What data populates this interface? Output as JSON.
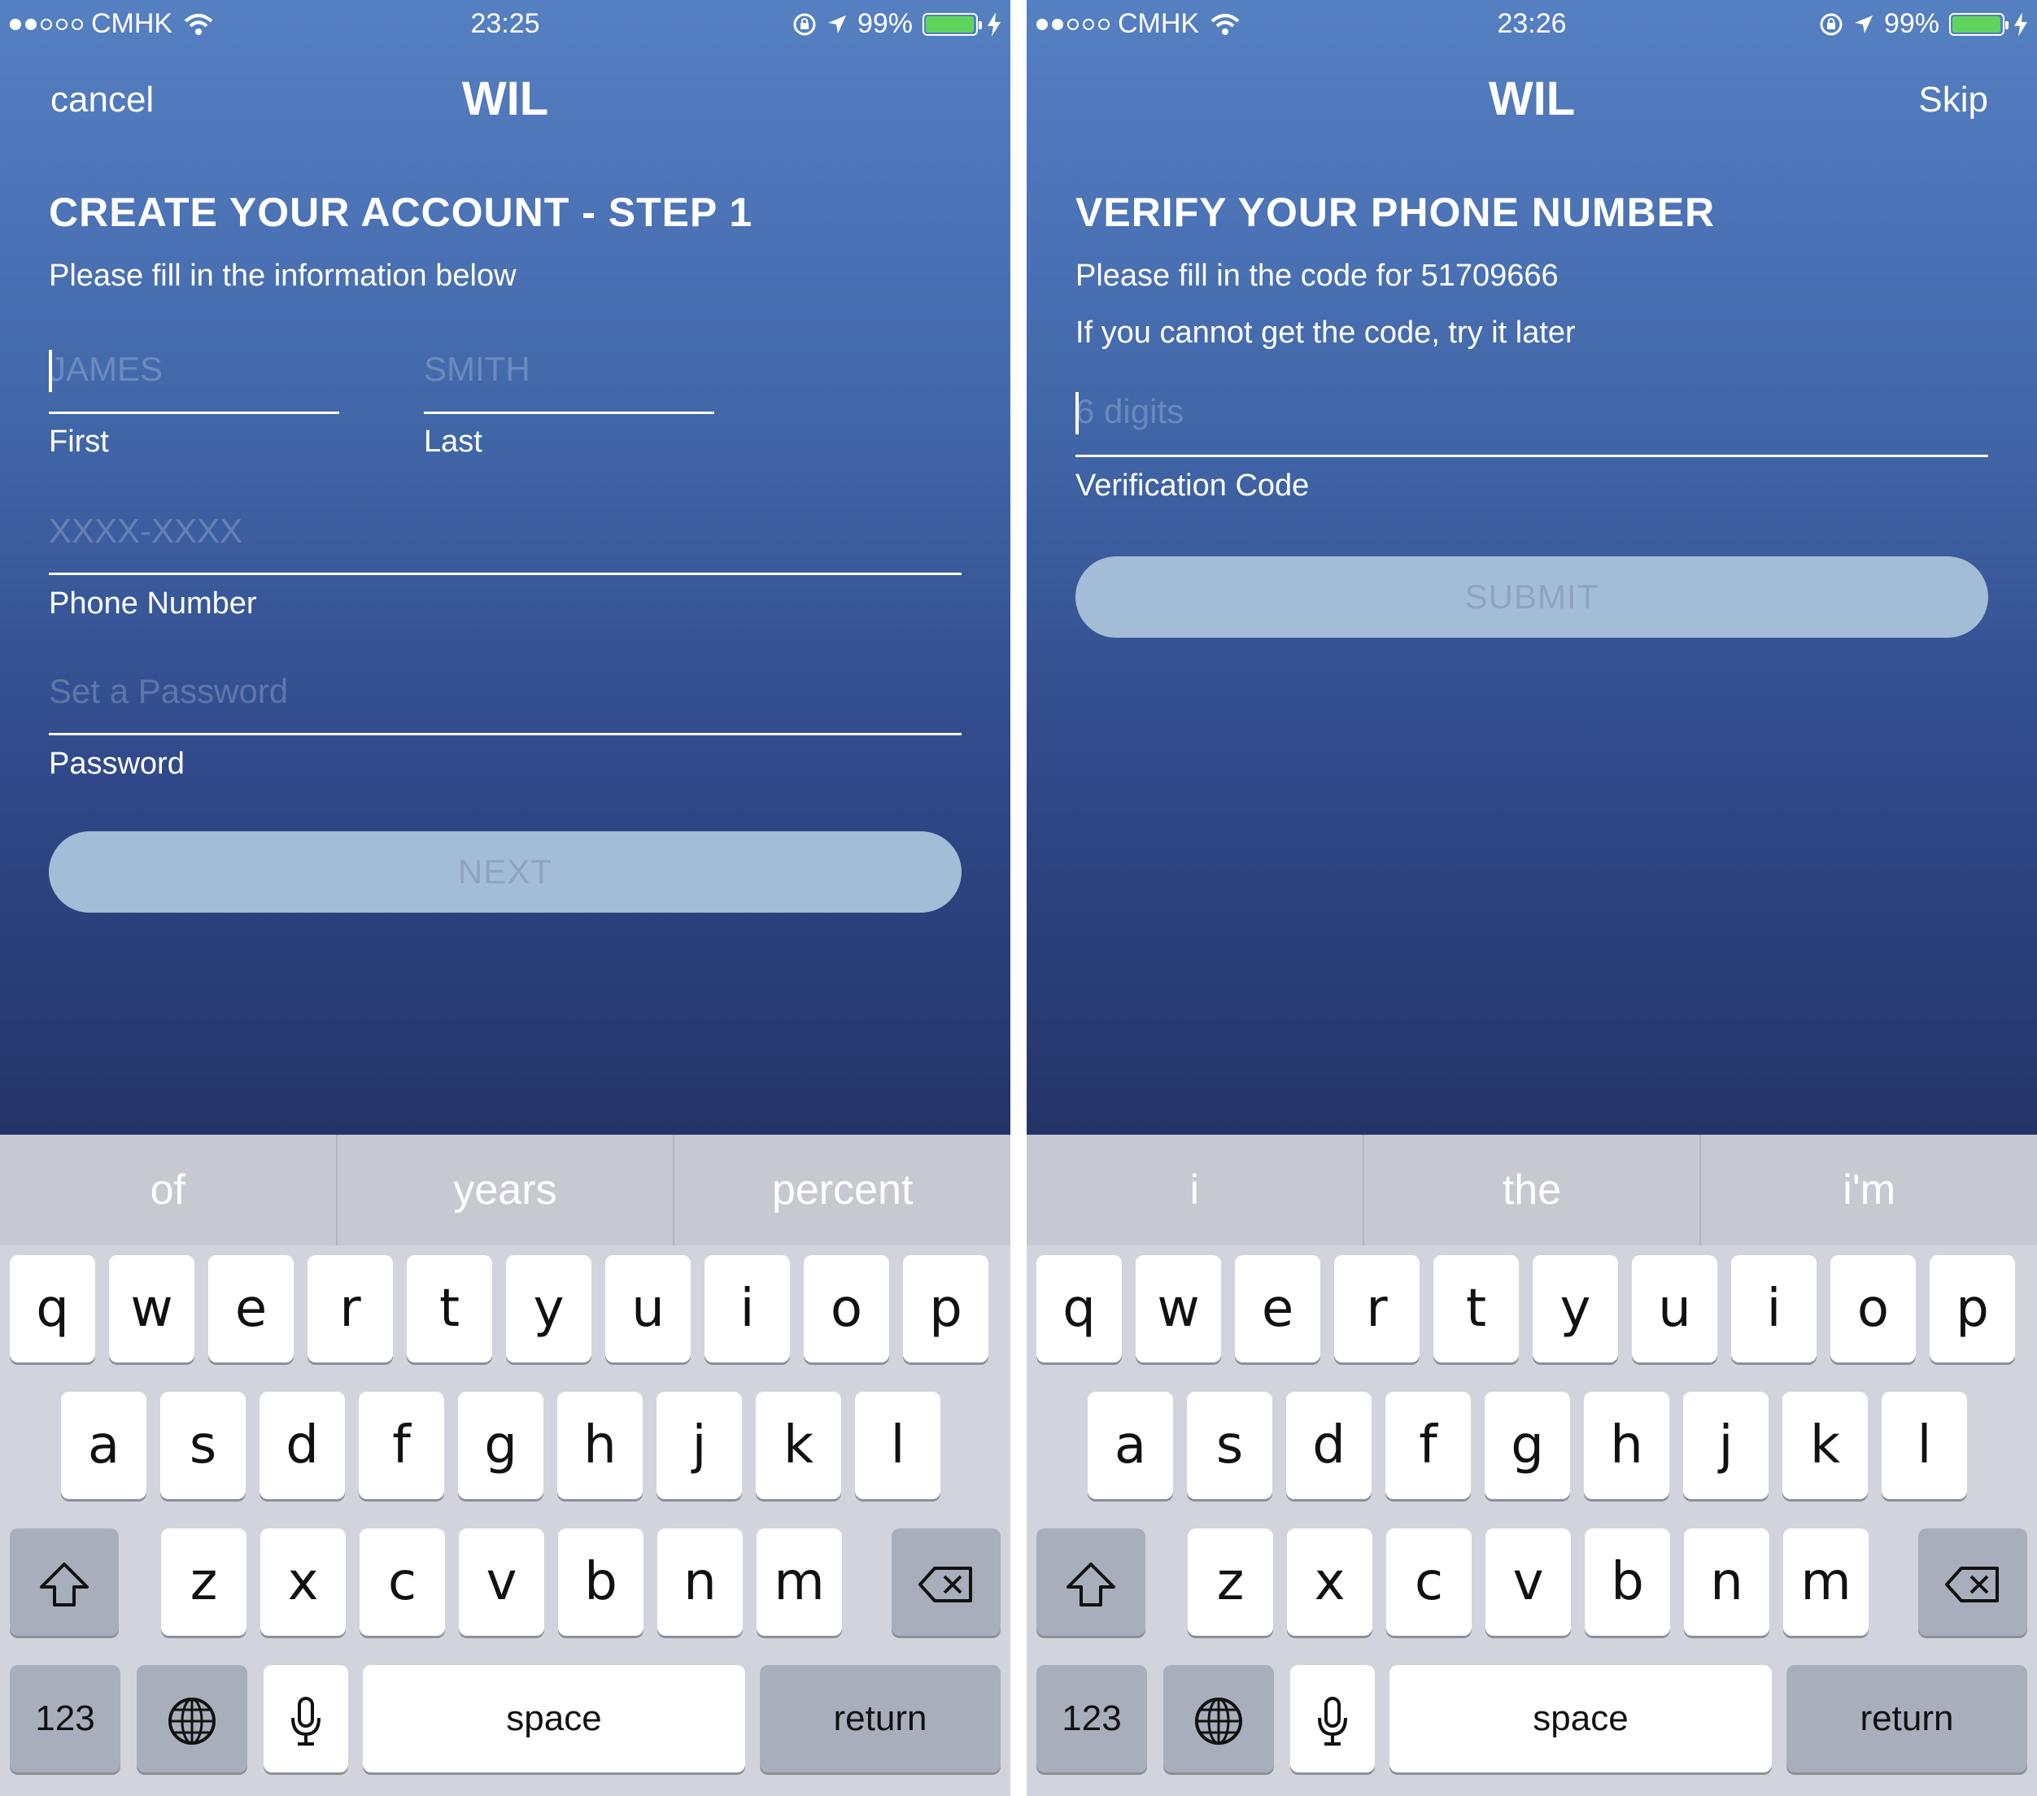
{
  "status_left": {
    "carrier": "CMHK",
    "time": "23:25",
    "battery": "99%",
    "battery_level": 0.99
  },
  "status_right": {
    "carrier": "CMHK",
    "time": "23:26",
    "battery": "99%",
    "battery_level": 0.99
  },
  "left_screen": {
    "nav": {
      "cancel": "cancel",
      "title": "WIL"
    },
    "heading": "CREATE YOUR ACCOUNT - STEP 1",
    "subtitle": "Please fill in the information below",
    "first_name": {
      "placeholder": "JAMES",
      "label": "First"
    },
    "last_name": {
      "placeholder": "SMITH",
      "label": "Last"
    },
    "phone": {
      "placeholder": "XXXX-XXXX",
      "label": "Phone Number"
    },
    "password": {
      "placeholder": "Set a Password",
      "label": "Password"
    },
    "next_button": "NEXT",
    "suggestions": [
      "of",
      "years",
      "percent"
    ]
  },
  "right_screen": {
    "nav": {
      "title": "WIL",
      "skip": "Skip"
    },
    "heading": "VERIFY YOUR PHONE NUMBER",
    "line1": "Please fill in the code for 51709666",
    "line2": "If you cannot get the code, try it later",
    "code": {
      "placeholder": "6 digits",
      "label": "Verification Code"
    },
    "submit_button": "SUBMIT",
    "suggestions": [
      "i",
      "the",
      "i'm"
    ]
  },
  "keyboard": {
    "row1": [
      "q",
      "w",
      "e",
      "r",
      "t",
      "y",
      "u",
      "i",
      "o",
      "p"
    ],
    "row2": [
      "a",
      "s",
      "d",
      "f",
      "g",
      "h",
      "j",
      "k",
      "l"
    ],
    "row3": [
      "z",
      "x",
      "c",
      "v",
      "b",
      "n",
      "m"
    ],
    "numbers": "123",
    "space": "space",
    "return": "return",
    "icons": [
      "shift-icon",
      "backspace-icon",
      "globe-icon",
      "microphone-icon"
    ]
  }
}
